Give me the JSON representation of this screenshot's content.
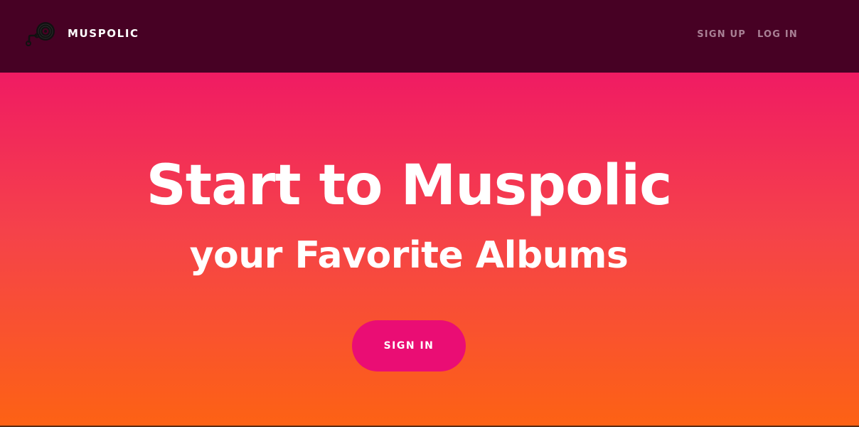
{
  "header": {
    "brand_name": "MUSPOLIC",
    "brand_icon": "vinyl-record-music-note-icon",
    "nav": {
      "signup_label": "SIGN UP",
      "login_label": "LOG IN"
    }
  },
  "hero": {
    "title": "Start to Muspolic",
    "subtitle": "your Favorite Albums",
    "signin_label": "SIGN IN"
  },
  "colors": {
    "navbar_bg": "#470124",
    "nav_link": "#a98095",
    "gradient_top": "#f01b63",
    "gradient_bottom": "#fd6214",
    "button_bg": "#ea0d74",
    "text": "#ffffff"
  }
}
